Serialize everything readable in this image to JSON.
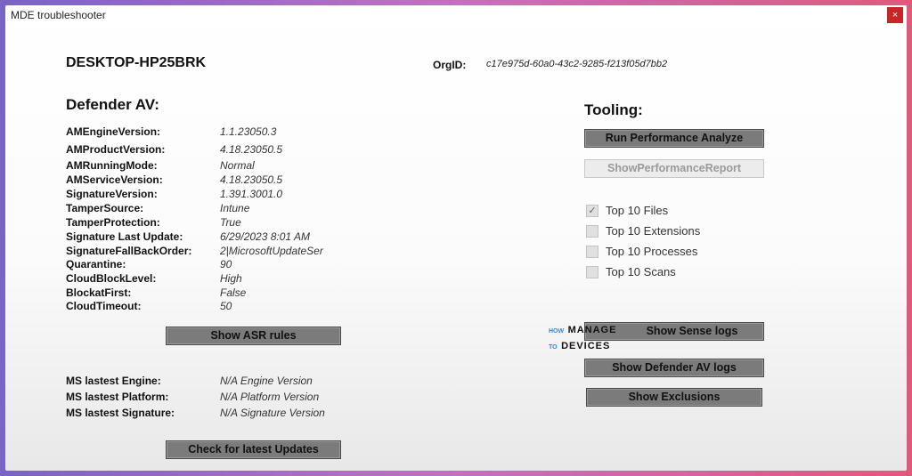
{
  "window": {
    "title": "MDE troubleshooter",
    "close": "×"
  },
  "header": {
    "hostname": "DESKTOP-HP25BRK",
    "orgid_label": "OrgID:",
    "orgid_value": "c17e975d-60a0-43c2-9285-f213f05d7bb2"
  },
  "defender": {
    "heading": "Defender AV:",
    "rows": [
      {
        "label": "AMEngineVersion:",
        "value": "1.1.23050.3"
      },
      {
        "label": "AMProductVersion:",
        "value": "4.18.23050.5"
      },
      {
        "label": "AMRunningMode:",
        "value": "Normal"
      },
      {
        "label": "AMServiceVersion:",
        "value": "4.18.23050.5"
      },
      {
        "label": "SignatureVersion:",
        "value": "1.391.3001.0"
      },
      {
        "label": "TamperSource:",
        "value": "Intune"
      },
      {
        "label": "TamperProtection:",
        "value": "True"
      },
      {
        "label": "Signature Last Update:",
        "value": "6/29/2023 8:01 AM"
      },
      {
        "label": "SignatureFallBackOrder:",
        "value": "2|MicrosoftUpdateSer"
      },
      {
        "label": "Quarantine:",
        "value": "90"
      },
      {
        "label": "CloudBlockLevel:",
        "value": "High"
      },
      {
        "label": "BlockatFirst:",
        "value": "False"
      },
      {
        "label": "CloudTimeout:",
        "value": "50"
      }
    ],
    "show_asr_label": "Show ASR rules"
  },
  "latest": {
    "rows": [
      {
        "label": "MS lastest Engine:",
        "value": "N/A Engine Version"
      },
      {
        "label": "MS lastest Platform:",
        "value": "N/A Platform Version"
      },
      {
        "label": "MS lastest Signature:",
        "value": "N/A Signature Version"
      }
    ],
    "check_label": "Check for latest Updates"
  },
  "tooling": {
    "heading": "Tooling:",
    "run_perf_label": "Run Performance Analyze",
    "show_report_label": "ShowPerformanceReport",
    "checkboxes": [
      {
        "label": "Top 10 Files",
        "checked": true
      },
      {
        "label": "Top 10 Extensions",
        "checked": false
      },
      {
        "label": "Top 10 Processes",
        "checked": false
      },
      {
        "label": "Top 10 Scans",
        "checked": false
      }
    ],
    "sense_logs_label": "Show Sense logs",
    "defender_logs_label": "Show Defender AV logs",
    "exclusions_label": "Show Exclusions"
  },
  "watermark": {
    "line1a": "HOW",
    "line1b": "MANAGE",
    "line2a": "TO",
    "line2b": "DEVICES"
  },
  "icons": {
    "checkbox_check": "check-icon"
  }
}
